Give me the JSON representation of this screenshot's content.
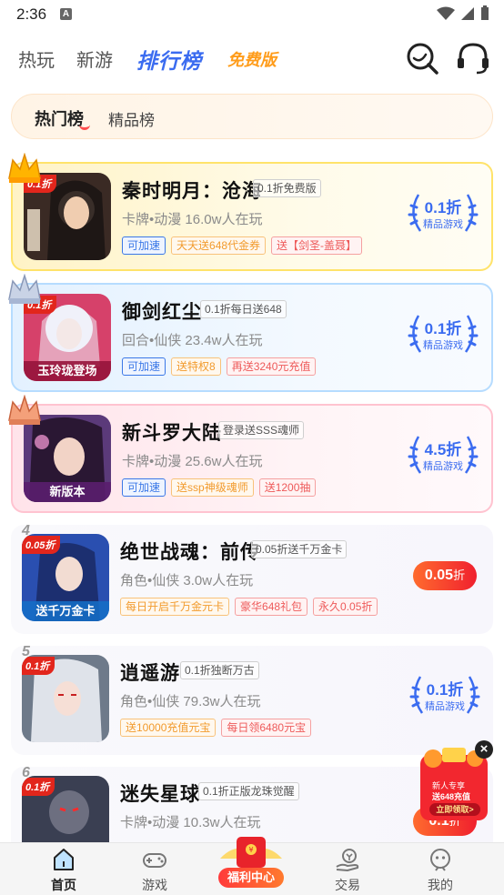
{
  "status_bar": {
    "time": "2:36",
    "notification_icon": "A"
  },
  "nav": {
    "tabs": [
      {
        "label": "热玩"
      },
      {
        "label": "新游"
      },
      {
        "label": "排行榜"
      },
      {
        "label": "免费版"
      }
    ],
    "active_tab": "排行榜",
    "icons": [
      "search-icon",
      "headset-icon"
    ]
  },
  "ranking_switch": {
    "hot": "热门榜",
    "best": "精品榜"
  },
  "games": [
    {
      "rank": "1",
      "name": "秦时明月：沧海",
      "badge": "0.1折免费版",
      "meta": "卡牌•动漫  16.0w人在玩",
      "tags": [
        "可加速",
        "天天送648代金券",
        "送【剑圣-盖聂】"
      ],
      "discount": "0.1折",
      "discount_sub": "精品游戏",
      "icon_badge": "0.1折",
      "icon_strip": ""
    },
    {
      "rank": "2",
      "name": "御剑红尘",
      "badge": "0.1折每日送648",
      "meta": "回合•仙侠  23.4w人在玩",
      "tags": [
        "可加速",
        "送特权8",
        "再送3240元充值"
      ],
      "discount": "0.1折",
      "discount_sub": "精品游戏",
      "icon_badge": "0.1折",
      "icon_strip": "玉玲珑登场"
    },
    {
      "rank": "3",
      "name": "新斗罗大陆",
      "badge": "登录送SSS魂师",
      "meta": "卡牌•动漫  25.6w人在玩",
      "tags": [
        "可加速",
        "送ssp神级魂师",
        "送1200抽"
      ],
      "discount": "4.5折",
      "discount_sub": "精品游戏",
      "icon_badge": "",
      "icon_strip": "新版本"
    },
    {
      "rank": "4",
      "name": "绝世战魂：前传",
      "badge": "0.05折送千万金卡",
      "meta": "角色•仙侠  3.0w人在玩",
      "tags": [
        "每日开启千万金元卡",
        "豪华648礼包",
        "永久0.05折"
      ],
      "discount_value": "0.05",
      "discount_unit": "折",
      "icon_badge": "0.05折",
      "icon_strip": "送千万金卡"
    },
    {
      "rank": "5",
      "name": "逍遥游",
      "badge": "0.1折独断万古",
      "meta": "角色•仙侠  79.3w人在玩",
      "tags": [
        "送10000充值元宝",
        "每日领6480元宝"
      ],
      "discount": "0.1折",
      "discount_sub": "精品游戏",
      "icon_badge": "0.1折",
      "icon_strip": ""
    },
    {
      "rank": "6",
      "name": "迷失星球",
      "badge": "0.1折正版龙珠觉醒",
      "meta": "卡牌•动漫  10.3w人在玩",
      "tags": [],
      "discount_value": "0.1",
      "discount_unit": "折",
      "icon_badge": "0.1折",
      "icon_strip": ""
    }
  ],
  "promo": {
    "line1": "新人专享",
    "line2": "送648充值",
    "button": "立即领取>",
    "close": "×"
  },
  "bottom_nav": [
    {
      "label": "首页"
    },
    {
      "label": "游戏"
    },
    {
      "label": "福利中心"
    },
    {
      "label": "交易"
    },
    {
      "label": "我的"
    }
  ],
  "colors": {
    "accent": "#3b6cf0",
    "hot_red": "#f0202e",
    "free_orange": "#ff9c1a"
  }
}
